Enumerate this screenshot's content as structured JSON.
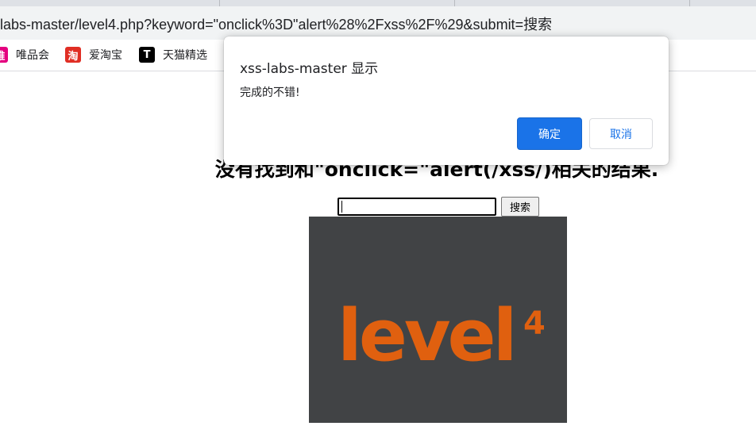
{
  "browser": {
    "url": "labs-master/level4.php?keyword=\"onclick%3D\"alert%28%2Fxss%2F%29&submit=搜索"
  },
  "bookmarks": [
    {
      "label": "唯品会",
      "icon": "vip-logo-icon",
      "icon_text": "唯",
      "color": "#e4007f"
    },
    {
      "label": "爱淘宝",
      "icon": "taobao-logo-icon",
      "icon_text": "淘",
      "color": "#e02e24"
    },
    {
      "label": "天猫精选",
      "icon": "tmall-logo-icon",
      "icon_text": "T",
      "color": "#000000"
    }
  ],
  "page": {
    "result_heading": "没有找到和\"onclick=\"alert(/xss/)相关的结果.",
    "search_button": "搜索",
    "level_image": {
      "text": "level",
      "superscript": "4",
      "bg_color": "#414345",
      "text_color": "#e0600f"
    }
  },
  "dialog": {
    "title": "xss-labs-master 显示",
    "message": "完成的不错!",
    "ok_label": "确定",
    "cancel_label": "取消"
  }
}
